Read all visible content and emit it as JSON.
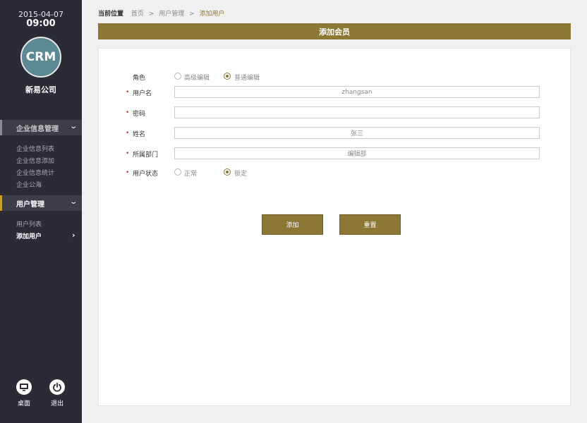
{
  "sidebar": {
    "date": "2015-04-07",
    "time": "09:00",
    "logo_text": "CRM",
    "company": "新易公司",
    "menu1": {
      "title": "企业信息管理",
      "items": [
        "企业信息列表",
        "企业信息添加",
        "企业信息统计",
        "企业公海"
      ]
    },
    "menu2": {
      "title": "用户管理",
      "items": [
        "用户列表",
        "添加用户"
      ]
    },
    "bottom": {
      "desktop_label": "桌面",
      "logout_label": "退出"
    },
    "accent_color": "#c9a227"
  },
  "breadcrumb": {
    "prefix": "当前位置",
    "items": [
      "首页",
      "用户管理",
      "添加用户"
    ],
    "separator": ">"
  },
  "page": {
    "title": "添加会员",
    "primary_color": "#8c7734"
  },
  "form": {
    "role": {
      "label": "角色",
      "options": [
        "高级编辑",
        "普通编辑"
      ],
      "selected": "普通编辑"
    },
    "username": {
      "label": "用户名",
      "value": "zhangsan"
    },
    "password": {
      "label": "密码",
      "value": ""
    },
    "name": {
      "label": "姓名",
      "value": "张三"
    },
    "department": {
      "label": "所属部门",
      "value": "编辑部"
    },
    "status": {
      "label": "用户状态",
      "options": [
        "正常",
        "锁定"
      ],
      "selected": "锁定"
    },
    "required_mark": "•"
  },
  "buttons": {
    "add": "添加",
    "reset": "重置"
  }
}
